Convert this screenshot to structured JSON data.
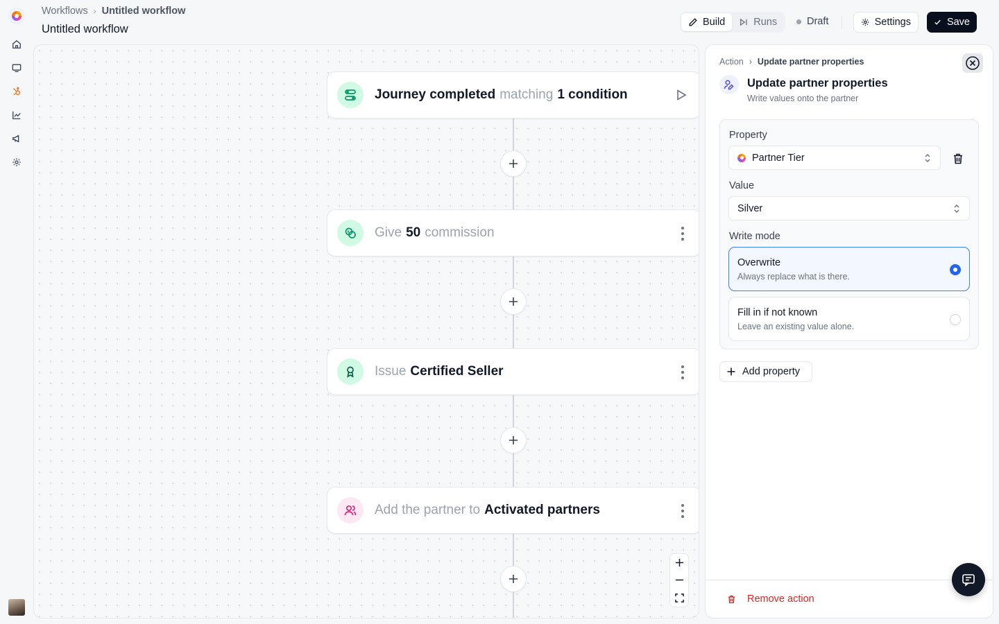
{
  "header": {
    "breadcrumb_root": "Workflows",
    "breadcrumb_current": "Untitled workflow",
    "title": "Untitled workflow",
    "tabs": [
      {
        "label": "Build",
        "icon": "pencil-icon",
        "active": true
      },
      {
        "label": "Runs",
        "icon": "skip-forward-icon",
        "active": false
      }
    ],
    "status": "Draft",
    "settings_label": "Settings",
    "save_label": "Save"
  },
  "sidebar": {
    "items": [
      "home-icon",
      "monitor-icon",
      "hubspot-icon",
      "chart-icon",
      "megaphone-icon",
      "gear-icon"
    ],
    "accent": "#f97316"
  },
  "workflow": {
    "nodes": [
      {
        "parts": [
          {
            "text": "Journey completed",
            "bold": true
          },
          {
            "text": "matching",
            "bold": false
          },
          {
            "text": "1 condition",
            "bold": true
          }
        ],
        "icon": "flow-icon",
        "color": "#10b981",
        "trailing": "play-icon"
      },
      {
        "parts": [
          {
            "text": "Give",
            "bold": false
          },
          {
            "text": "50",
            "bold": true
          },
          {
            "text": "commission",
            "bold": false
          }
        ],
        "icon": "coins-icon",
        "color": "#10b981",
        "trailing": "more-icon"
      },
      {
        "parts": [
          {
            "text": "Issue",
            "bold": false
          },
          {
            "text": "Certified Seller",
            "bold": true
          }
        ],
        "icon": "award-icon",
        "color": "#10b981",
        "trailing": "more-icon"
      },
      {
        "parts": [
          {
            "text": "Add the partner to",
            "bold": false
          },
          {
            "text": "Activated partners",
            "bold": true
          }
        ],
        "icon": "users-icon",
        "color": "#db2777",
        "trailing": "more-icon"
      }
    ]
  },
  "panel": {
    "breadcrumb_root": "Action",
    "breadcrumb_current": "Update partner properties",
    "title": "Update partner properties",
    "subtitle": "Write values onto the partner",
    "property_label": "Property",
    "property_value": "Partner Tier",
    "value_label": "Value",
    "value_value": "Silver",
    "write_mode_label": "Write mode",
    "options": [
      {
        "title": "Overwrite",
        "desc": "Always replace what is there.",
        "selected": true
      },
      {
        "title": "Fill in if not known",
        "desc": "Leave an existing value alone.",
        "selected": false
      }
    ],
    "add_property_label": "Add property",
    "remove_label": "Remove action",
    "accent": "#2563eb",
    "danger": "#dc2626"
  }
}
